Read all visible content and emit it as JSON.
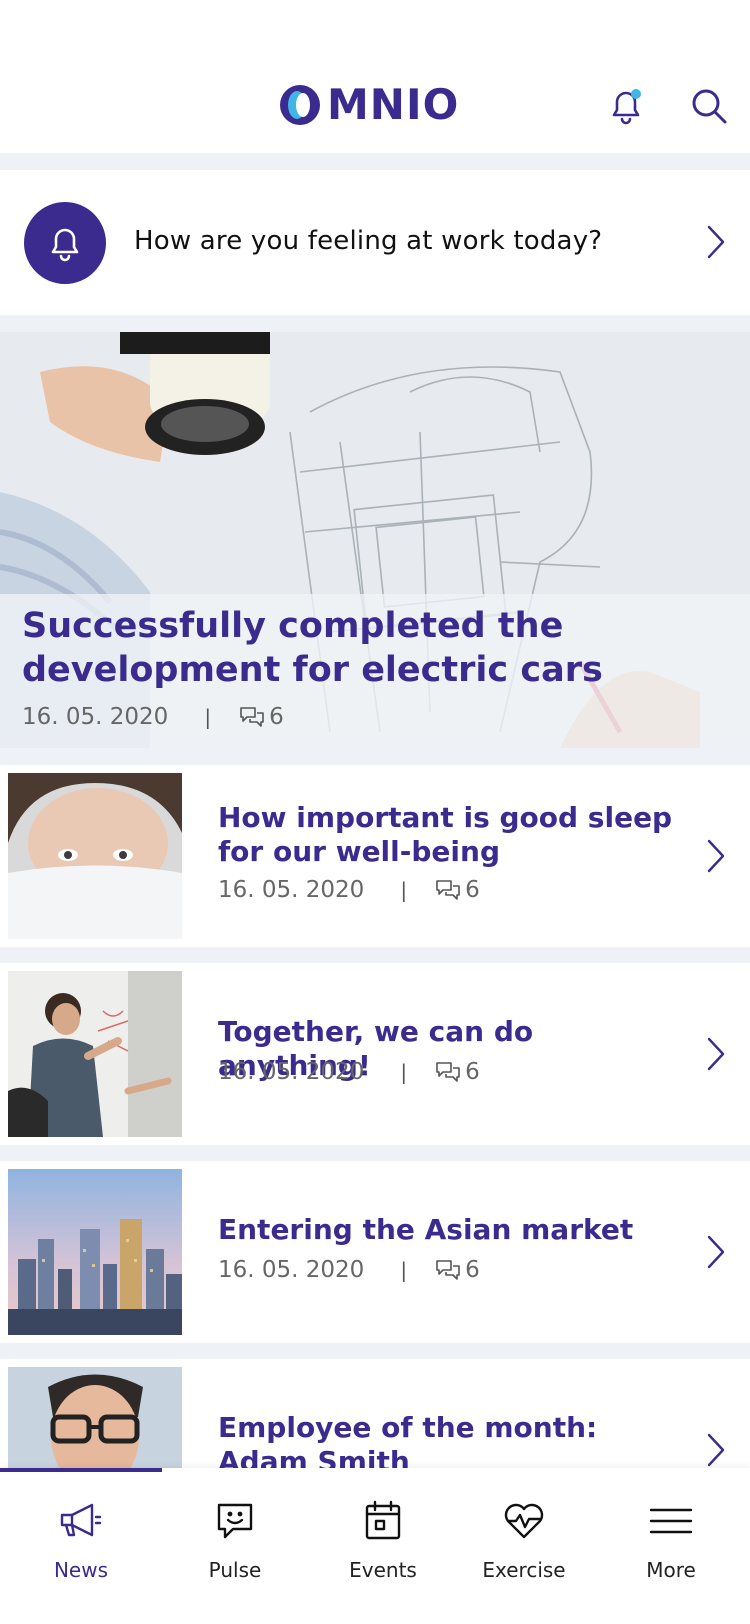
{
  "app": {
    "logo_text": "MNIO",
    "brand_color": "#3b2b8f",
    "accent_color": "#3fb6e6"
  },
  "header": {
    "notification_icon": "bell-icon",
    "search_icon": "search-icon"
  },
  "prompt": {
    "text": "How are you feeling at work today?",
    "icon": "bell-icon"
  },
  "hero": {
    "title": "Successfully completed the development for electric cars",
    "date": "16. 05. 2020",
    "separator": "|",
    "comments": "6"
  },
  "articles": [
    {
      "title": "How important is good sleep for our well-being",
      "date": "16. 05. 2020",
      "separator": "|",
      "comments": "6"
    },
    {
      "title": "Together, we can do anything!",
      "date": "16. 05. 2020",
      "separator": "|",
      "comments": "6"
    },
    {
      "title": "Entering the Asian market",
      "date": "16. 05. 2020",
      "separator": "|",
      "comments": "6"
    },
    {
      "title": "Employee of the month: Adam Smith"
    }
  ],
  "tabs": [
    {
      "label": "News",
      "icon": "megaphone-icon",
      "active": true
    },
    {
      "label": "Pulse",
      "icon": "chat-smile-icon",
      "active": false
    },
    {
      "label": "Events",
      "icon": "calendar-icon",
      "active": false
    },
    {
      "label": "Exercise",
      "icon": "heart-pulse-icon",
      "active": false
    },
    {
      "label": "More",
      "icon": "menu-icon",
      "active": false
    }
  ]
}
